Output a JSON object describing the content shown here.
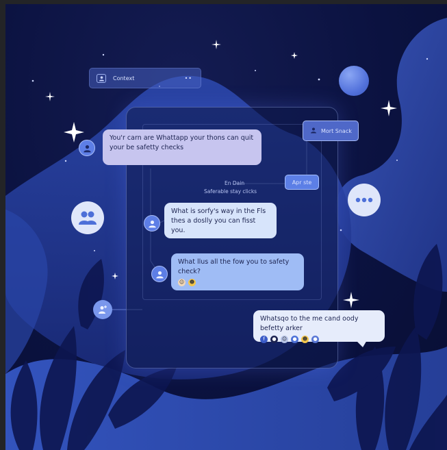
{
  "context_chip": {
    "label": "Context",
    "dots": "••"
  },
  "mark_chip": {
    "label": "Mort Snack"
  },
  "apply_chip": {
    "label": "Apr ste"
  },
  "flow_label": {
    "line1": "En Dain",
    "line2": "Saferable stay clicks"
  },
  "messages": [
    {
      "text": "You'r carn are Whattapp your thons can quit your be safetty checks"
    },
    {
      "text": "What is sorfy's way in the Fls thes a doslly you can fisst you."
    },
    {
      "text": "What llus all the fow you to safety check?"
    },
    {
      "text": "Whatsqo to the me cand oody befetty arker"
    }
  ],
  "colors": {
    "background": "#0b1240",
    "accent": "#5c7fe6",
    "bubble_lavender": "#c7c5ef",
    "bubble_light": "#d7e4fb",
    "bubble_blue": "#9fbcf5"
  },
  "icons": [
    "users-icon",
    "more-dots-icon",
    "add-person-icon",
    "person-icon",
    "sparkle-icon",
    "leaf-icon"
  ]
}
